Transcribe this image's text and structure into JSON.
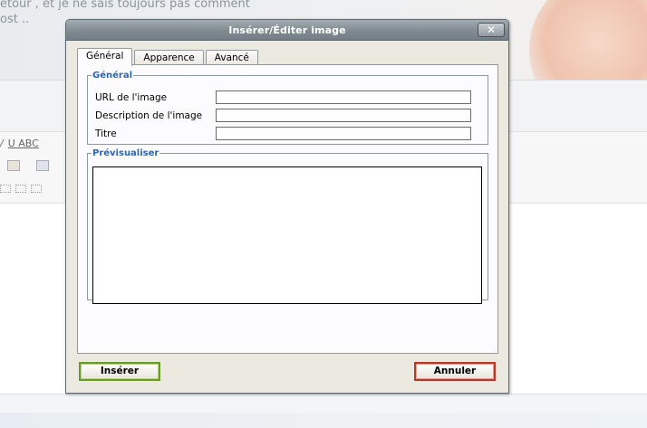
{
  "background": {
    "line1": "etour , et je ne sais toujours pas comment",
    "line2": "ost ..",
    "toolbar_text": "U ABC"
  },
  "dialog": {
    "title": "Insérer/Éditer image",
    "close_label": "✕",
    "tabs": [
      {
        "label": "Général",
        "active": true
      },
      {
        "label": "Apparence",
        "active": false
      },
      {
        "label": "Avancé",
        "active": false
      }
    ],
    "general_group": {
      "legend": "Général",
      "fields": [
        {
          "label": "URL de l'image",
          "value": ""
        },
        {
          "label": "Description de l'image",
          "value": ""
        },
        {
          "label": "Titre",
          "value": ""
        }
      ]
    },
    "preview_group": {
      "legend": "Prévisualiser"
    },
    "buttons": {
      "insert": "Insérer",
      "cancel": "Annuler"
    }
  }
}
